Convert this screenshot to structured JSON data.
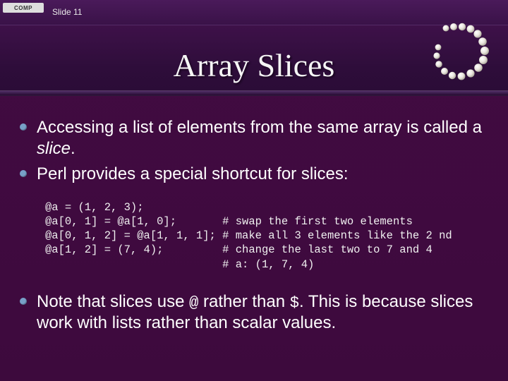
{
  "header": {
    "logo_text": "COMP",
    "slide_label": "Slide 11"
  },
  "title": "Array Slices",
  "bullets": [
    {
      "pre": "Accessing a list of elements from the same array is called a ",
      "em": "slice",
      "post": "."
    },
    {
      "pre": "Perl provides a special shortcut for slices:",
      "em": "",
      "post": ""
    }
  ],
  "code": {
    "lines": [
      "@a = (1, 2, 3);",
      "@a[0, 1] = @a[1, 0];       # swap the first two elements",
      "@a[0, 1, 2] = @a[1, 1, 1]; # make all 3 elements like the 2 nd",
      "@a[1, 2] = (7, 4);         # change the last two to 7 and 4",
      "                           # a: (1, 7, 4)"
    ]
  },
  "closing": {
    "pre": "Note that slices use ",
    "sym1": "@",
    "mid": " rather than ",
    "sym2": "$",
    "post": ". This is because slices work with lists rather than scalar values."
  }
}
